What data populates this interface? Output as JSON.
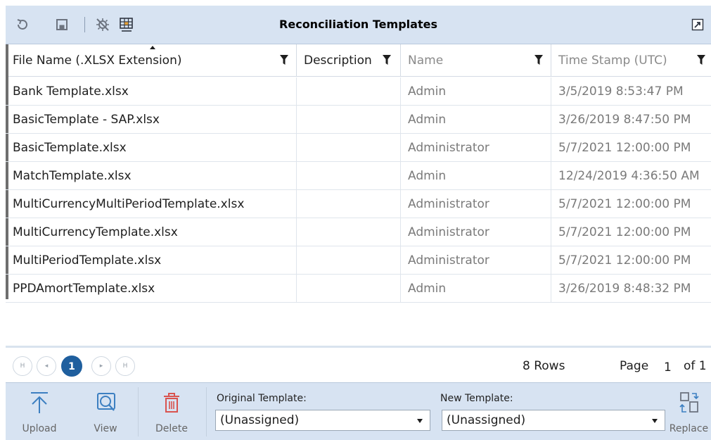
{
  "window": {
    "title": "Reconciliation Templates"
  },
  "toolbar": {
    "icons": [
      "refresh-icon",
      "save-icon",
      "settings-off-icon",
      "grid-settings-icon"
    ],
    "popout_icon": "popout-icon"
  },
  "grid": {
    "columns": [
      {
        "label": "File Name (.XLSX Extension)",
        "sorted": "ascending"
      },
      {
        "label": "Description"
      },
      {
        "label": "Name"
      },
      {
        "label": "Time Stamp (UTC)"
      }
    ],
    "rows": [
      {
        "file": "Bank Template.xlsx",
        "description": "",
        "name": "Admin",
        "timestamp": "3/5/2019 8:53:47 PM"
      },
      {
        "file": "BasicTemplate - SAP.xlsx",
        "description": "",
        "name": "Admin",
        "timestamp": "3/26/2019 8:47:50 PM"
      },
      {
        "file": "BasicTemplate.xlsx",
        "description": "",
        "name": "Administrator",
        "timestamp": "5/7/2021 12:00:00 PM"
      },
      {
        "file": "MatchTemplate.xlsx",
        "description": "",
        "name": "Admin",
        "timestamp": "12/24/2019 4:36:50 AM"
      },
      {
        "file": "MultiCurrencyMultiPeriodTemplate.xlsx",
        "description": "",
        "name": "Administrator",
        "timestamp": "5/7/2021 12:00:00 PM"
      },
      {
        "file": "MultiCurrencyTemplate.xlsx",
        "description": "",
        "name": "Administrator",
        "timestamp": "5/7/2021 12:00:00 PM"
      },
      {
        "file": "MultiPeriodTemplate.xlsx",
        "description": "",
        "name": "Administrator",
        "timestamp": "5/7/2021 12:00:00 PM"
      },
      {
        "file": "PPDAmortTemplate.xlsx",
        "description": "",
        "name": "Admin",
        "timestamp": "3/26/2019 8:48:32 PM"
      }
    ]
  },
  "pager": {
    "first": "H",
    "prev": "◂",
    "current_page": "1",
    "next": "▸",
    "last": "H",
    "rows_count": "8 Rows",
    "page_label": "Page",
    "page_value": "1",
    "page_of": "of 1"
  },
  "actions": {
    "upload": "Upload",
    "view": "View",
    "delete": "Delete",
    "replace": "Replace"
  },
  "template_selects": {
    "original_label": "Original Template:",
    "original_value": "(Unassigned)",
    "new_label": "New Template:",
    "new_value": "(Unassigned)"
  },
  "colors": {
    "toolbar_bg": "#d7e3f2",
    "accent": "#1f5f9e",
    "delete_red": "#d9534f",
    "icon_blue": "#3c7fc1"
  }
}
